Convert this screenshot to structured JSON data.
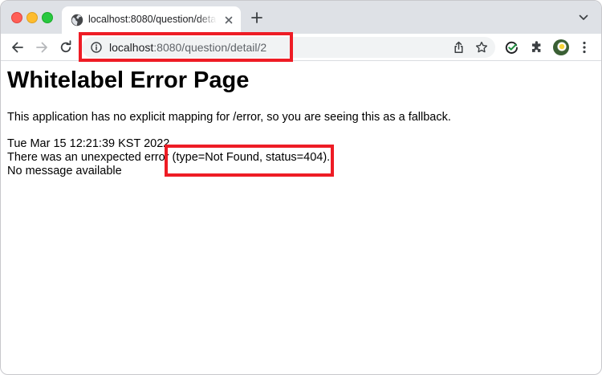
{
  "browser": {
    "tab": {
      "title": "localhost:8080/question/detail/2",
      "favicon": "globe-icon"
    },
    "address_bar": {
      "host": "localhost",
      "path": ":8080/question/detail/2"
    },
    "traffic_light_colors": {
      "close": "#ff5f57",
      "minimize": "#febc2e",
      "maximize": "#28c840"
    },
    "icons": {
      "back": "arrow-left-icon",
      "forward": "arrow-right-icon",
      "reload": "reload-icon",
      "site_info": "info-icon",
      "share": "share-icon",
      "bookmark": "star-icon",
      "extension_1": "check-circle-icon",
      "extensions": "puzzle-icon",
      "menu": "kebab-menu-icon"
    }
  },
  "page": {
    "title": "Whitelabel Error Page",
    "explanation": "This application has no explicit mapping for /error, so you are seeing this as a fallback.",
    "timestamp": "Tue Mar 15 12:21:39 KST 2022",
    "error_prefix": "There was an unexpected error ",
    "error_detail": "(type=Not Found, status=404).",
    "message": "No message available"
  },
  "annotations": {
    "highlight_color": "#ee1c25"
  }
}
